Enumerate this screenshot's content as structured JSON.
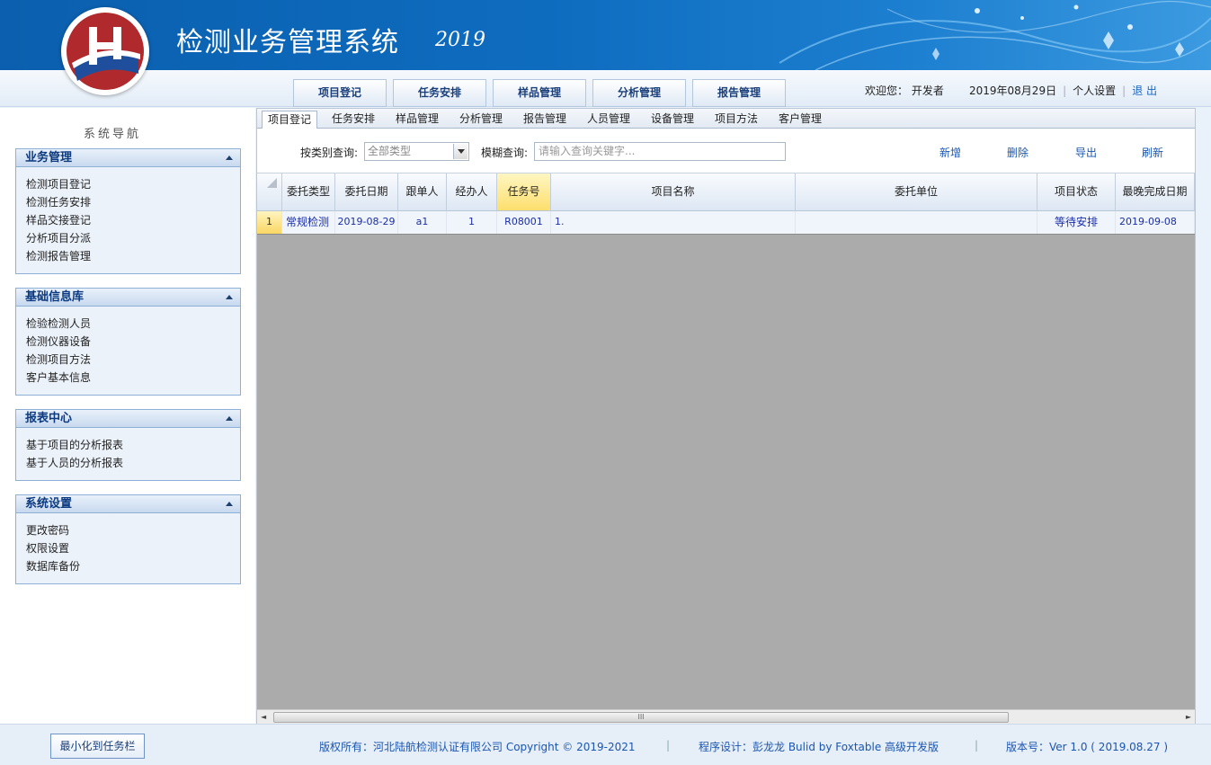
{
  "header": {
    "title": "检测业务管理系统",
    "year": "2019"
  },
  "topnav": {
    "buttons": [
      "项目登记",
      "任务安排",
      "样品管理",
      "分析管理",
      "报告管理"
    ]
  },
  "userbar": {
    "welcome": "欢迎您：",
    "username": "开发者",
    "date": "2019年08月29日",
    "settings": "个人设置",
    "logout": "退 出"
  },
  "sidebar": {
    "title": "系统导航",
    "panels": [
      {
        "title": "业务管理",
        "items": [
          "检测项目登记",
          "检测任务安排",
          "样品交接登记",
          "分析项目分派",
          "检测报告管理"
        ]
      },
      {
        "title": "基础信息库",
        "items": [
          "检验检测人员",
          "检测仪器设备",
          "检测项目方法",
          "客户基本信息"
        ]
      },
      {
        "title": "报表中心",
        "items": [
          "基于项目的分析报表",
          "基于人员的分析报表"
        ]
      },
      {
        "title": "系统设置",
        "items": [
          "更改密码",
          "权限设置",
          "数据库备份"
        ]
      }
    ]
  },
  "tabs": [
    "项目登记",
    "任务安排",
    "样品管理",
    "分析管理",
    "报告管理",
    "人员管理",
    "设备管理",
    "项目方法",
    "客户管理"
  ],
  "toolbar": {
    "type_label": "按类别查询:",
    "type_value": "全部类型",
    "search_label": "模糊查询:",
    "search_placeholder": "请输入查询关键字...",
    "actions": [
      "新增",
      "删除",
      "导出",
      "刷新"
    ]
  },
  "grid": {
    "columns": [
      "委托类型",
      "委托日期",
      "跟单人",
      "经办人",
      "任务号",
      "项目名称",
      "委托单位",
      "项目状态",
      "最晚完成日期"
    ],
    "rows": [
      {
        "num": "1",
        "cells": [
          "常规检测",
          "2019-08-29",
          "a1",
          "1",
          "R08001",
          "1.",
          "",
          "等待安排",
          "2019-09-08"
        ]
      }
    ],
    "scroll_grip": "III"
  },
  "footer": {
    "minimize": "最小化到任务栏",
    "copyright": "版权所有：河北陆航检测认证有限公司 Copyright © 2019-2021",
    "designer": "程序设计：彭龙龙 Bulid by Foxtable 高级开发版",
    "version": "版本号：Ver 1.0 ( 2019.08.27 )"
  },
  "colors": {
    "header_blue": "#0e6cbf",
    "link_blue": "#1a56b0",
    "highlight_yellow": "#fddf6d",
    "logo_red": "#b0292c"
  }
}
